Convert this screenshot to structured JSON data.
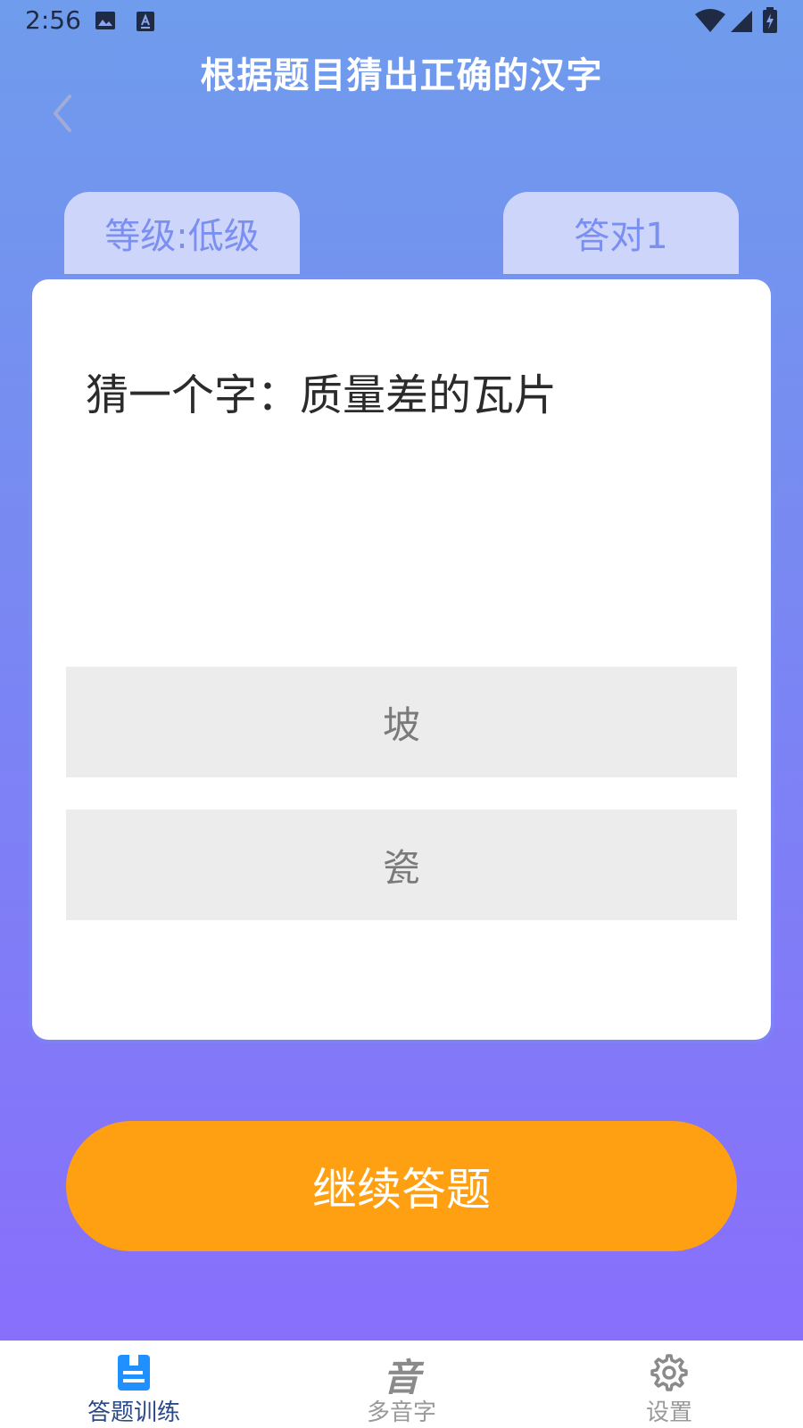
{
  "status_bar": {
    "time": "2:56",
    "icons": [
      "image-icon",
      "text-a-icon",
      "wifi-icon",
      "cellular-icon",
      "battery-charging-icon"
    ]
  },
  "header": {
    "title": "根据题目猜出正确的汉字",
    "back_icon": "chevron-left-icon"
  },
  "tabs": {
    "level": "等级:低级",
    "correct": "答对1"
  },
  "question": {
    "text": "猜一个字：质量差的瓦片",
    "options": [
      "坡",
      "瓷"
    ]
  },
  "continue_button": {
    "label": "继续答题"
  },
  "bottom_nav": {
    "items": [
      {
        "label": "答题训练",
        "icon": "quiz-icon",
        "active": true
      },
      {
        "label": "多音字",
        "icon": "yin-icon",
        "glyph": "音",
        "active": false
      },
      {
        "label": "设置",
        "icon": "gear-icon",
        "active": false
      }
    ]
  },
  "colors": {
    "accent_orange": "#ff9f12",
    "tab_bg": "#cdd5fa",
    "tab_text": "#7b8ff0",
    "nav_active": "#2a4a8a",
    "nav_icon_active": "#1e90ff"
  }
}
